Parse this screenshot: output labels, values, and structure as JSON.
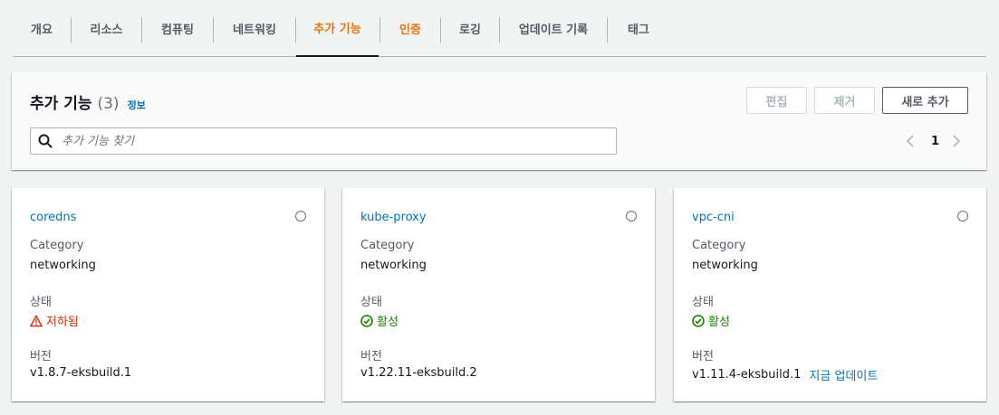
{
  "tabs": [
    {
      "label": "개요"
    },
    {
      "label": "리소스"
    },
    {
      "label": "컴퓨팅"
    },
    {
      "label": "네트워킹"
    },
    {
      "label": "추가 기능"
    },
    {
      "label": "인증"
    },
    {
      "label": "로깅"
    },
    {
      "label": "업데이트 기록"
    },
    {
      "label": "태그"
    }
  ],
  "panel": {
    "title": "추가 기능",
    "count": "(3)",
    "info": "정보",
    "buttons": {
      "edit": "편집",
      "remove": "제거",
      "add": "새로 추가"
    },
    "search_placeholder": "추가 기능 찾기",
    "page": "1"
  },
  "cards": [
    {
      "name": "coredns",
      "category_label": "Category",
      "category": "networking",
      "status_label": "상태",
      "status": "저하됨",
      "version_label": "버전",
      "version": "v1.8.7-eksbuild.1"
    },
    {
      "name": "kube-proxy",
      "category_label": "Category",
      "category": "networking",
      "status_label": "상태",
      "status": "활성",
      "version_label": "버전",
      "version": "v1.22.11-eksbuild.2"
    },
    {
      "name": "vpc-cni",
      "category_label": "Category",
      "category": "networking",
      "status_label": "상태",
      "status": "활성",
      "version_label": "버전",
      "version": "v1.11.4-eksbuild.1",
      "update_link": "지금 업데이트"
    }
  ],
  "colors": {
    "accent": "#ec7211",
    "link": "#0073bb",
    "degraded": "#d13212",
    "active": "#1d8102"
  },
  "icons": {
    "search": "search-icon",
    "warning": "warning-icon",
    "check": "check-circle-icon",
    "prev": "chevron-left-icon",
    "next": "chevron-right-icon"
  }
}
